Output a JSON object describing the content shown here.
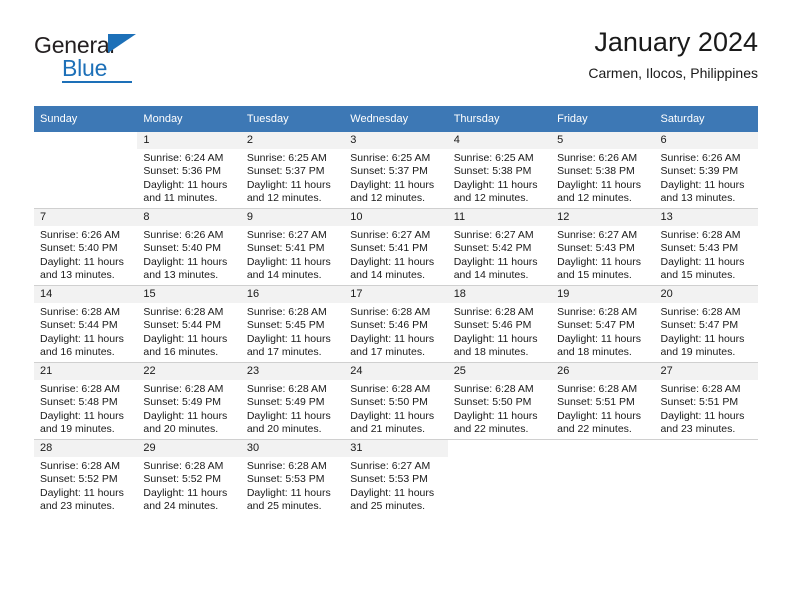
{
  "brand": {
    "name_part1": "General",
    "name_part2": "Blue",
    "accent_color": "#1d70b8",
    "triangle_icon": "triangle-icon"
  },
  "header": {
    "title": "January 2024",
    "subtitle": "Carmen, Ilocos, Philippines"
  },
  "calendar": {
    "header_bg": "#3d78b5",
    "daynum_bg": "#f2f2f2",
    "weekday_headers": [
      "Sunday",
      "Monday",
      "Tuesday",
      "Wednesday",
      "Thursday",
      "Friday",
      "Saturday"
    ],
    "weeks": [
      [
        {
          "day": "",
          "l1": "",
          "l2": "",
          "l3": "",
          "l4": "",
          "blank": true
        },
        {
          "day": "1",
          "l1": "Sunrise: 6:24 AM",
          "l2": "Sunset: 5:36 PM",
          "l3": "Daylight: 11 hours",
          "l4": "and 11 minutes."
        },
        {
          "day": "2",
          "l1": "Sunrise: 6:25 AM",
          "l2": "Sunset: 5:37 PM",
          "l3": "Daylight: 11 hours",
          "l4": "and 12 minutes."
        },
        {
          "day": "3",
          "l1": "Sunrise: 6:25 AM",
          "l2": "Sunset: 5:37 PM",
          "l3": "Daylight: 11 hours",
          "l4": "and 12 minutes."
        },
        {
          "day": "4",
          "l1": "Sunrise: 6:25 AM",
          "l2": "Sunset: 5:38 PM",
          "l3": "Daylight: 11 hours",
          "l4": "and 12 minutes."
        },
        {
          "day": "5",
          "l1": "Sunrise: 6:26 AM",
          "l2": "Sunset: 5:38 PM",
          "l3": "Daylight: 11 hours",
          "l4": "and 12 minutes."
        },
        {
          "day": "6",
          "l1": "Sunrise: 6:26 AM",
          "l2": "Sunset: 5:39 PM",
          "l3": "Daylight: 11 hours",
          "l4": "and 13 minutes."
        }
      ],
      [
        {
          "day": "7",
          "l1": "Sunrise: 6:26 AM",
          "l2": "Sunset: 5:40 PM",
          "l3": "Daylight: 11 hours",
          "l4": "and 13 minutes."
        },
        {
          "day": "8",
          "l1": "Sunrise: 6:26 AM",
          "l2": "Sunset: 5:40 PM",
          "l3": "Daylight: 11 hours",
          "l4": "and 13 minutes."
        },
        {
          "day": "9",
          "l1": "Sunrise: 6:27 AM",
          "l2": "Sunset: 5:41 PM",
          "l3": "Daylight: 11 hours",
          "l4": "and 14 minutes."
        },
        {
          "day": "10",
          "l1": "Sunrise: 6:27 AM",
          "l2": "Sunset: 5:41 PM",
          "l3": "Daylight: 11 hours",
          "l4": "and 14 minutes."
        },
        {
          "day": "11",
          "l1": "Sunrise: 6:27 AM",
          "l2": "Sunset: 5:42 PM",
          "l3": "Daylight: 11 hours",
          "l4": "and 14 minutes."
        },
        {
          "day": "12",
          "l1": "Sunrise: 6:27 AM",
          "l2": "Sunset: 5:43 PM",
          "l3": "Daylight: 11 hours",
          "l4": "and 15 minutes."
        },
        {
          "day": "13",
          "l1": "Sunrise: 6:28 AM",
          "l2": "Sunset: 5:43 PM",
          "l3": "Daylight: 11 hours",
          "l4": "and 15 minutes."
        }
      ],
      [
        {
          "day": "14",
          "l1": "Sunrise: 6:28 AM",
          "l2": "Sunset: 5:44 PM",
          "l3": "Daylight: 11 hours",
          "l4": "and 16 minutes."
        },
        {
          "day": "15",
          "l1": "Sunrise: 6:28 AM",
          "l2": "Sunset: 5:44 PM",
          "l3": "Daylight: 11 hours",
          "l4": "and 16 minutes."
        },
        {
          "day": "16",
          "l1": "Sunrise: 6:28 AM",
          "l2": "Sunset: 5:45 PM",
          "l3": "Daylight: 11 hours",
          "l4": "and 17 minutes."
        },
        {
          "day": "17",
          "l1": "Sunrise: 6:28 AM",
          "l2": "Sunset: 5:46 PM",
          "l3": "Daylight: 11 hours",
          "l4": "and 17 minutes."
        },
        {
          "day": "18",
          "l1": "Sunrise: 6:28 AM",
          "l2": "Sunset: 5:46 PM",
          "l3": "Daylight: 11 hours",
          "l4": "and 18 minutes."
        },
        {
          "day": "19",
          "l1": "Sunrise: 6:28 AM",
          "l2": "Sunset: 5:47 PM",
          "l3": "Daylight: 11 hours",
          "l4": "and 18 minutes."
        },
        {
          "day": "20",
          "l1": "Sunrise: 6:28 AM",
          "l2": "Sunset: 5:47 PM",
          "l3": "Daylight: 11 hours",
          "l4": "and 19 minutes."
        }
      ],
      [
        {
          "day": "21",
          "l1": "Sunrise: 6:28 AM",
          "l2": "Sunset: 5:48 PM",
          "l3": "Daylight: 11 hours",
          "l4": "and 19 minutes."
        },
        {
          "day": "22",
          "l1": "Sunrise: 6:28 AM",
          "l2": "Sunset: 5:49 PM",
          "l3": "Daylight: 11 hours",
          "l4": "and 20 minutes."
        },
        {
          "day": "23",
          "l1": "Sunrise: 6:28 AM",
          "l2": "Sunset: 5:49 PM",
          "l3": "Daylight: 11 hours",
          "l4": "and 20 minutes."
        },
        {
          "day": "24",
          "l1": "Sunrise: 6:28 AM",
          "l2": "Sunset: 5:50 PM",
          "l3": "Daylight: 11 hours",
          "l4": "and 21 minutes."
        },
        {
          "day": "25",
          "l1": "Sunrise: 6:28 AM",
          "l2": "Sunset: 5:50 PM",
          "l3": "Daylight: 11 hours",
          "l4": "and 22 minutes."
        },
        {
          "day": "26",
          "l1": "Sunrise: 6:28 AM",
          "l2": "Sunset: 5:51 PM",
          "l3": "Daylight: 11 hours",
          "l4": "and 22 minutes."
        },
        {
          "day": "27",
          "l1": "Sunrise: 6:28 AM",
          "l2": "Sunset: 5:51 PM",
          "l3": "Daylight: 11 hours",
          "l4": "and 23 minutes."
        }
      ],
      [
        {
          "day": "28",
          "l1": "Sunrise: 6:28 AM",
          "l2": "Sunset: 5:52 PM",
          "l3": "Daylight: 11 hours",
          "l4": "and 23 minutes."
        },
        {
          "day": "29",
          "l1": "Sunrise: 6:28 AM",
          "l2": "Sunset: 5:52 PM",
          "l3": "Daylight: 11 hours",
          "l4": "and 24 minutes."
        },
        {
          "day": "30",
          "l1": "Sunrise: 6:28 AM",
          "l2": "Sunset: 5:53 PM",
          "l3": "Daylight: 11 hours",
          "l4": "and 25 minutes."
        },
        {
          "day": "31",
          "l1": "Sunrise: 6:27 AM",
          "l2": "Sunset: 5:53 PM",
          "l3": "Daylight: 11 hours",
          "l4": "and 25 minutes."
        },
        {
          "day": "",
          "l1": "",
          "l2": "",
          "l3": "",
          "l4": "",
          "blank": true
        },
        {
          "day": "",
          "l1": "",
          "l2": "",
          "l3": "",
          "l4": "",
          "blank": true
        },
        {
          "day": "",
          "l1": "",
          "l2": "",
          "l3": "",
          "l4": "",
          "blank": true
        }
      ]
    ]
  }
}
